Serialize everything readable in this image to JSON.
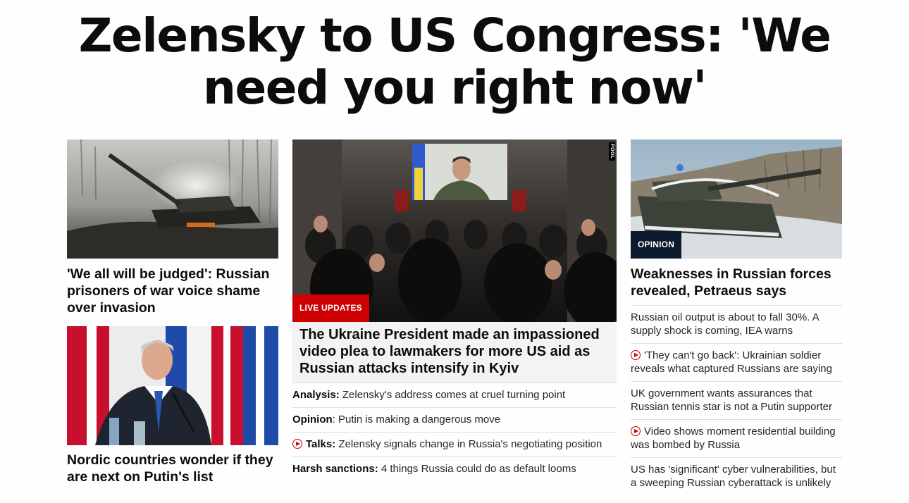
{
  "headline": "Zelensky to US Congress: 'We need you right now'",
  "left": {
    "story1": {
      "title": "'We all will be judged': Russian prisoners of war voice shame over invasion"
    },
    "story2": {
      "title": "Nordic countries wonder if they are next on Putin's list"
    }
  },
  "middle": {
    "badge": "LIVE UPDATES",
    "credit": "POOL",
    "title": "The Ukraine President made an impassioned video plea to lawmakers for more US aid as Russian attacks intensify in Kyiv",
    "items": [
      {
        "bold": "Analysis:",
        "text": " Zelensky's address comes at cruel turning point",
        "video": false
      },
      {
        "bold": "Opinion",
        "text": ": Putin is making a dangerous move",
        "video": false
      },
      {
        "bold": "Talks:",
        "text": " Zelensky signals change in Russia's negotiating position",
        "video": true
      },
      {
        "bold": "Harsh sanctions:",
        "text": " 4 things Russia could do as default looms",
        "video": false
      }
    ]
  },
  "right": {
    "badge": "OPINION",
    "title": "Weaknesses in Russian forces revealed, Petraeus says",
    "items": [
      {
        "text": "Russian oil output is about to fall 30%. A supply shock is coming, IEA warns",
        "video": false
      },
      {
        "text": "'They can't go back': Ukrainian soldier reveals what captured Russians are saying",
        "video": true
      },
      {
        "text": "UK government wants assurances that Russian tennis star is not a Putin supporter",
        "video": false
      },
      {
        "text": "Video shows moment residential building was bombed by Russia",
        "video": true
      },
      {
        "text": "US has 'significant' cyber vulnerabilities, but a sweeping Russian cyberattack is unlikely",
        "video": false
      }
    ]
  },
  "colors": {
    "accent_red": "#cc0000",
    "opinion_navy": "#0c1a2e"
  },
  "icons": {
    "video": "play-circle-icon"
  }
}
